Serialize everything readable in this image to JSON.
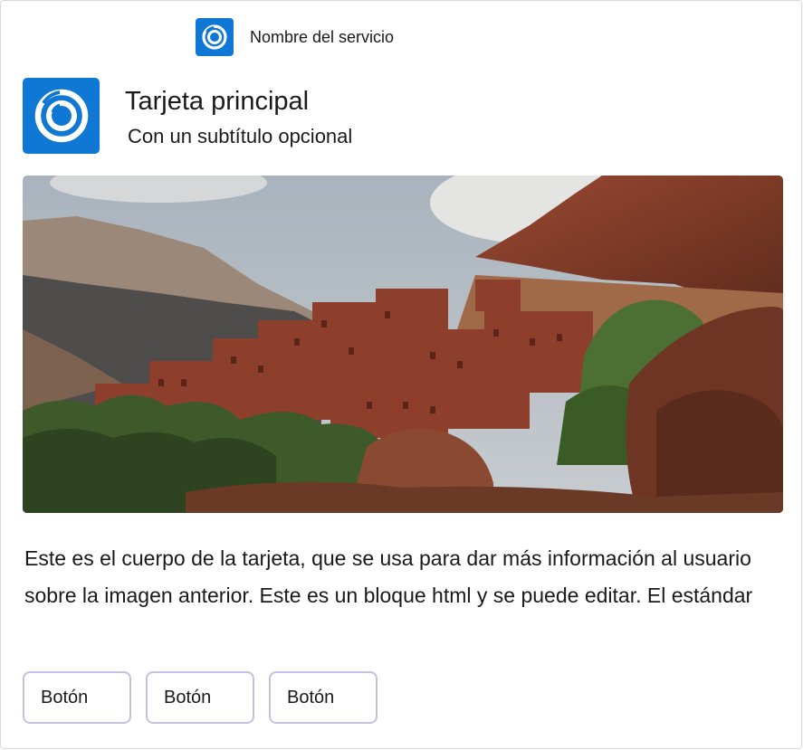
{
  "service": {
    "name": "Nombre del servicio",
    "icon": "ring-logo-icon"
  },
  "card": {
    "title": "Tarjeta principal",
    "subtitle": "Con un subtítulo opcional",
    "icon": "ring-logo-icon",
    "accent_color": "#0f78d4",
    "image": "mountain-village-photo",
    "body": "Este es el cuerpo de la tarjeta, que se usa para dar más información al usuario sobre la imagen anterior. Este es un bloque html y se puede editar. El estándar"
  },
  "buttons": [
    {
      "label": "Botón"
    },
    {
      "label": "Botón"
    },
    {
      "label": "Botón"
    }
  ],
  "button_border_color": "#c5c0e2"
}
